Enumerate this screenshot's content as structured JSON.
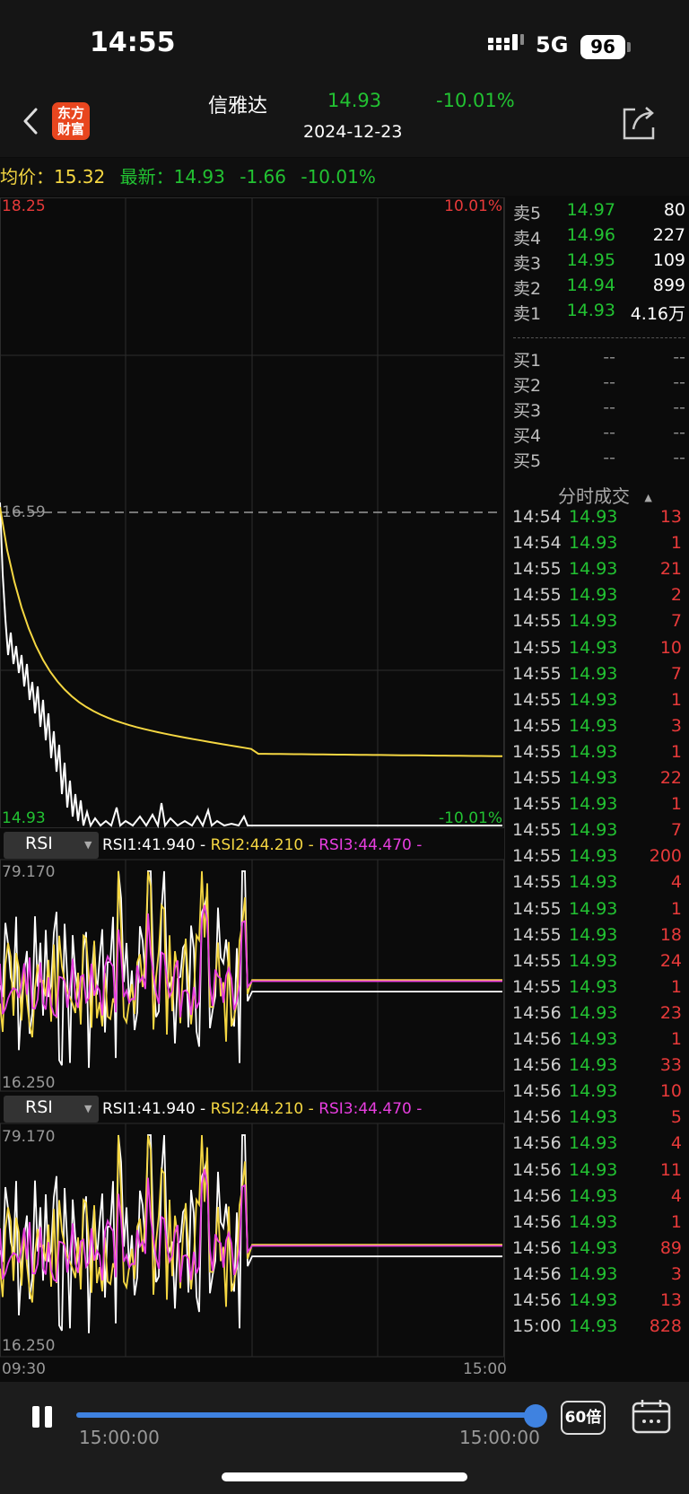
{
  "status_bar": {
    "time": "14:55",
    "network": "5G",
    "battery": "96"
  },
  "header": {
    "logo_line1": "东方",
    "logo_line2": "财富",
    "name": "信雅达",
    "price": "14.93",
    "change_pct": "-10.01%",
    "date": "2024-12-23"
  },
  "info_bar": {
    "avg_label": "均价：",
    "avg_value": "15.32",
    "latest_label": "最新：",
    "latest_value": "14.93",
    "change": "-1.66",
    "change_pct": "-10.01%"
  },
  "price_chart": {
    "y_top": "18.25",
    "y_top_pct": "10.01%",
    "ref_price": "16.59",
    "y_bottom": "14.93",
    "y_bottom_pct": "-10.01%",
    "x_start": "09:30",
    "x_end": "15:00"
  },
  "rsi_panels": [
    {
      "tab": "RSI",
      "rsi1": "RSI1:41.940 -",
      "rsi2": "RSI2:44.210 -",
      "rsi3": "RSI3:44.470 -",
      "y_top": "79.170",
      "y_bottom": "16.250"
    },
    {
      "tab": "RSI",
      "rsi1": "RSI1:41.940 -",
      "rsi2": "RSI2:44.210 -",
      "rsi3": "RSI3:44.470 -",
      "y_top": "79.170",
      "y_bottom": "16.250"
    }
  ],
  "order_book": {
    "asks": [
      {
        "label": "卖5",
        "price": "14.97",
        "vol": "80"
      },
      {
        "label": "卖4",
        "price": "14.96",
        "vol": "227"
      },
      {
        "label": "卖3",
        "price": "14.95",
        "vol": "109"
      },
      {
        "label": "卖2",
        "price": "14.94",
        "vol": "899"
      },
      {
        "label": "卖1",
        "price": "14.93",
        "vol": "4.16万"
      }
    ],
    "bids": [
      {
        "label": "买1",
        "price": "--",
        "vol": "--"
      },
      {
        "label": "买2",
        "price": "--",
        "vol": "--"
      },
      {
        "label": "买3",
        "price": "--",
        "vol": "--"
      },
      {
        "label": "买4",
        "price": "--",
        "vol": "--"
      },
      {
        "label": "买5",
        "price": "--",
        "vol": "--"
      }
    ]
  },
  "trades": {
    "title": "分时成交",
    "rows": [
      {
        "time": "14:54",
        "price": "14.93",
        "vol": "13"
      },
      {
        "time": "14:54",
        "price": "14.93",
        "vol": "1"
      },
      {
        "time": "14:55",
        "price": "14.93",
        "vol": "21"
      },
      {
        "time": "14:55",
        "price": "14.93",
        "vol": "2"
      },
      {
        "time": "14:55",
        "price": "14.93",
        "vol": "7"
      },
      {
        "time": "14:55",
        "price": "14.93",
        "vol": "10"
      },
      {
        "time": "14:55",
        "price": "14.93",
        "vol": "7"
      },
      {
        "time": "14:55",
        "price": "14.93",
        "vol": "1"
      },
      {
        "time": "14:55",
        "price": "14.93",
        "vol": "3"
      },
      {
        "time": "14:55",
        "price": "14.93",
        "vol": "1"
      },
      {
        "time": "14:55",
        "price": "14.93",
        "vol": "22"
      },
      {
        "time": "14:55",
        "price": "14.93",
        "vol": "1"
      },
      {
        "time": "14:55",
        "price": "14.93",
        "vol": "7"
      },
      {
        "time": "14:55",
        "price": "14.93",
        "vol": "200"
      },
      {
        "time": "14:55",
        "price": "14.93",
        "vol": "4"
      },
      {
        "time": "14:55",
        "price": "14.93",
        "vol": "1"
      },
      {
        "time": "14:55",
        "price": "14.93",
        "vol": "18"
      },
      {
        "time": "14:55",
        "price": "14.93",
        "vol": "24"
      },
      {
        "time": "14:55",
        "price": "14.93",
        "vol": "1"
      },
      {
        "time": "14:56",
        "price": "14.93",
        "vol": "23"
      },
      {
        "time": "14:56",
        "price": "14.93",
        "vol": "1"
      },
      {
        "time": "14:56",
        "price": "14.93",
        "vol": "33"
      },
      {
        "time": "14:56",
        "price": "14.93",
        "vol": "10"
      },
      {
        "time": "14:56",
        "price": "14.93",
        "vol": "5"
      },
      {
        "time": "14:56",
        "price": "14.93",
        "vol": "4"
      },
      {
        "time": "14:56",
        "price": "14.93",
        "vol": "11"
      },
      {
        "time": "14:56",
        "price": "14.93",
        "vol": "4"
      },
      {
        "time": "14:56",
        "price": "14.93",
        "vol": "1"
      },
      {
        "time": "14:56",
        "price": "14.93",
        "vol": "89"
      },
      {
        "time": "14:56",
        "price": "14.93",
        "vol": "3"
      },
      {
        "time": "14:56",
        "price": "14.93",
        "vol": "13"
      },
      {
        "time": "15:00",
        "price": "14.93",
        "vol": "828"
      }
    ]
  },
  "playback": {
    "start_time": "15:00:00",
    "end_time": "15:00:00",
    "speed": "60倍",
    "progress": 1.0
  },
  "colors": {
    "up": "#e83a3a",
    "down": "#22c232",
    "avg_line": "#f5d742",
    "rsi3": "#e83ee0",
    "accent": "#3f82e0"
  }
}
